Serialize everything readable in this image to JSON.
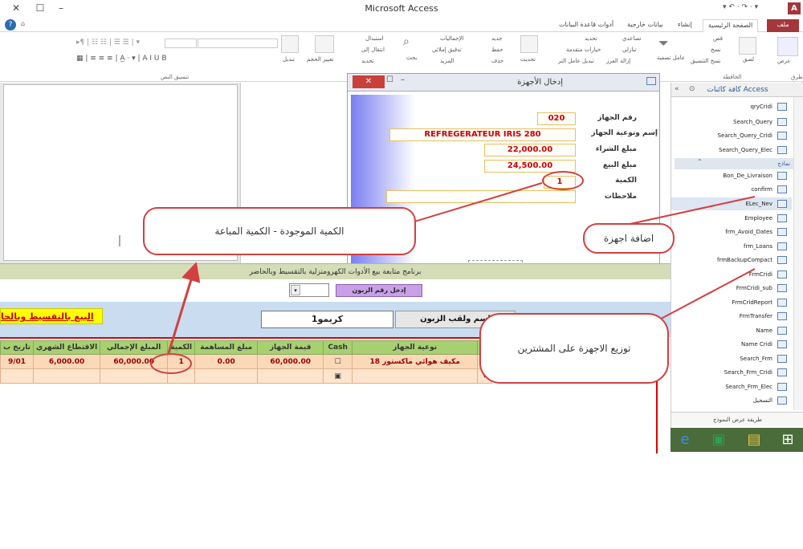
{
  "window": {
    "title": "Microsoft Access",
    "app_icon": "A"
  },
  "tabs": {
    "file": "ملف",
    "home": "الصفحة الرئيسية",
    "create": "إنشاء",
    "external": "بيانات خارجية",
    "db_tools": "أدوات قاعدة البيانات"
  },
  "ribbon": {
    "cut": "قص",
    "copy": "نسخ",
    "paste": "لصق",
    "format_painter": "نسخ التنسيق",
    "view": "عرض",
    "filter": "عامل تصفية",
    "ascending": "تصاعدي",
    "descending": "تنازلي",
    "remove_sort": "إزالة الفرز",
    "selection": "تحديد",
    "advanced": "خيارات متقدمة",
    "toggle_filter": "تبديل عامل التر",
    "refresh": "تحديث",
    "new": "جديد",
    "save": "حفظ",
    "delete": "حذف",
    "totals": "الإجماليات",
    "spelling": "تدقيق إملائي",
    "more": "المزيد",
    "find": "بحث",
    "replace": "استبدال",
    "goto": "انتقال إلى",
    "select": "تحديد",
    "size": "تغيير الحجم",
    "switch": "تبديل",
    "group_views": "طرق عرض",
    "group_clipboard": "الحافظة",
    "group_text": "تنسيق النص"
  },
  "dialog": {
    "title": "إدخال الأجهزة",
    "close_label": "✕",
    "labels": {
      "device_no": "رقم الجهاز",
      "device_name": "إسم ونوعية الجهاز",
      "purchase": "مبلغ الشراء",
      "sale": "مبلغ البيع",
      "qty": "الكمية",
      "notes": "ملاحظات"
    },
    "values": {
      "device_no": "020",
      "device_name": "REFREGERATEUR IRIS 280",
      "purchase": "22,000.00",
      "sale": "24,500.00",
      "qty": "1",
      "notes": ""
    }
  },
  "nav": {
    "header": "كافة كائنات Access",
    "queries": [
      "qryCridi",
      "Search_Query",
      "Search_Query_Cridi",
      "Search_Query_Elec"
    ],
    "forms_section": "نماذج",
    "forms": [
      "Bon_De_Livraison",
      "confirm",
      "ELec_Nev",
      "Employee",
      "frm_Avoid_Dates",
      "frm_Loans",
      "frmBackupCompact",
      "FrmCridi",
      "FrmCridi_sub",
      "FrmCridReport",
      "FrmTransfer",
      "Name",
      "Name Cridi",
      "Search_Frm",
      "Search_Frm_Cridi",
      "Search_Frm_Elec",
      "التسجيل"
    ],
    "footer": "طريقة عرض النموذج"
  },
  "form": {
    "program_title": "برنامج متابعة بيع الأدوات الكهرومنزلية بالتقسيط وبالحاضر",
    "customer_id_button": "إدخل رقم الزبون",
    "sale_title": "البيع بالتقسيط وبالحا",
    "customer_name_label": "اسم ولقب الزبون",
    "customer_name_value": "كريمو1",
    "columns": [
      "تاريخ ب",
      "الاقتطاع الشهري",
      "المبلغ الإجمالي",
      "الكمية",
      "مبلغ المساهمة",
      "قيمة الجهاز",
      "Cash",
      "نوعية الجهاز"
    ],
    "rows": [
      {
        "date": "9/01",
        "monthly": "6,000.00",
        "total": "60,000.00",
        "qty": "1",
        "contribution": "0.00",
        "value": "60,000.00",
        "device": "مكيف هوائي ماكستور 18"
      }
    ]
  },
  "annotations": {
    "qty_note": "الكمية الموجودة - الكمية المباعة",
    "add_devices": "اضافة اجهزة",
    "distribute": "توزيع الاجهزة على المشترين"
  },
  "colors": {
    "accent": "#a4373a",
    "callout_border": "#d24040",
    "grid_header": "#a8d070",
    "row_bg": "#fbd8b8"
  }
}
